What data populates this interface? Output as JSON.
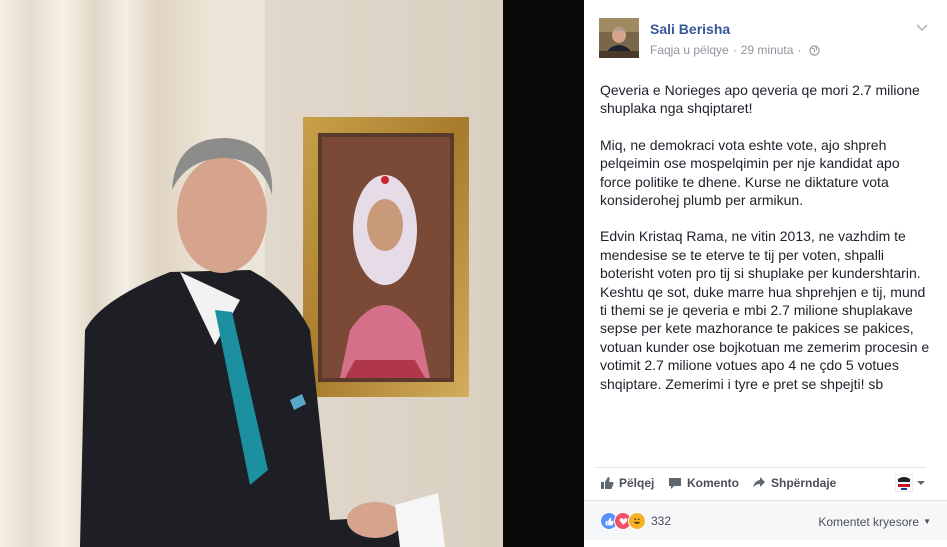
{
  "post": {
    "author": "Sali Berisha",
    "meta_page": "Faqja u pëlqye",
    "meta_time": "29 minuta",
    "paragraphs": [
      "Qeveria e Norieges apo qeveria qe mori 2.7 milione shuplaka nga shqiptaret!",
      "Miq, ne demokraci vota eshte vote, ajo shpreh pelqeimin ose mospelqimin per nje kandidat apo force politike te dhene. Kurse ne diktature vota konsiderohej plumb per armikun.",
      "Edvin Kristaq Rama, ne vitin 2013, ne vazhdim te mendesise se te eterve te tij per voten, shpalli boterisht voten pro tij si shuplake per kundershtarin. Keshtu qe sot, duke marre hua shprehjen e tij, mund ti themi se je qeveria e mbi 2.7 milione shuplakave sepse per kete mazhorance te pakices se pakices, votuan kunder ose bojkotuan me zemerim procesin e votimit 2.7 milione votues apo 4 ne çdo 5 votues shqiptare. Zemerimi i tyre e pret se shpejti! sb"
    ]
  },
  "actions": {
    "like": "Pëlqej",
    "comment": "Komento",
    "share": "Shpërndaje"
  },
  "reactions": {
    "count": "332",
    "sort_label": "Komentet kryesore"
  },
  "colors": {
    "link": "#365899",
    "meta": "#90949c",
    "like_blue": "#5890ff",
    "love_red": "#f25268",
    "haha_yellow": "#f7b125"
  }
}
